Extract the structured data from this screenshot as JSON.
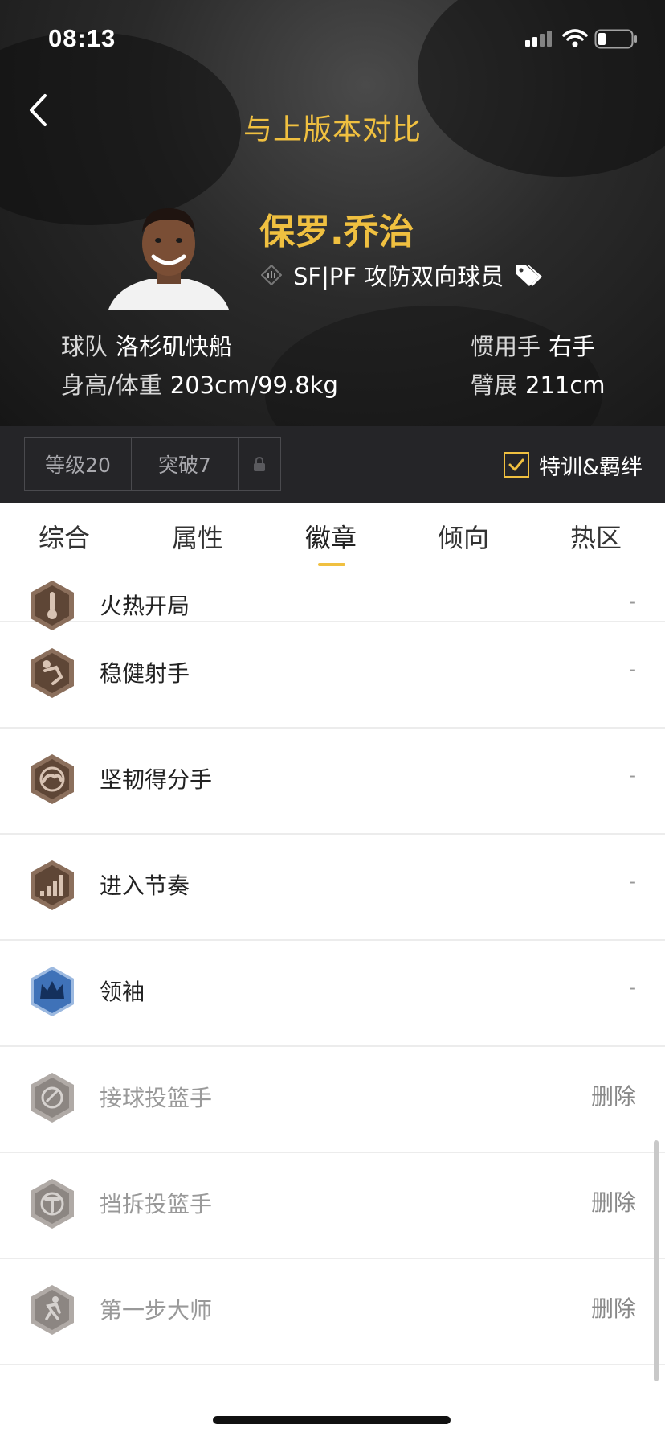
{
  "status_bar": {
    "time": "08:13"
  },
  "header": {
    "title": "与上版本对比"
  },
  "player": {
    "name": "保罗.乔治",
    "position": "SF|PF 攻防双向球员",
    "team_label": "球队",
    "team_value": "洛杉矶快船",
    "height_weight_label": "身高/体重",
    "height_weight_value": "203cm/99.8kg",
    "hand_label": "惯用手",
    "hand_value": "右手",
    "wingspan_label": "臂展",
    "wingspan_value": "211cm"
  },
  "level_bar": {
    "level": "等级20",
    "breakthrough": "突破7",
    "training_label": "特训&羁绊",
    "training_checked": true
  },
  "tabs": [
    {
      "label": "综合"
    },
    {
      "label": "属性"
    },
    {
      "label": "徽章",
      "active": true
    },
    {
      "label": "倾向"
    },
    {
      "label": "热区"
    }
  ],
  "badges": [
    {
      "name": "火热开局",
      "status": "-",
      "icon": "thermometer-badge-icon",
      "tier": "bronze"
    },
    {
      "name": "稳健射手",
      "status": "-",
      "icon": "shooter-badge-icon",
      "tier": "bronze"
    },
    {
      "name": "坚韧得分手",
      "status": "-",
      "icon": "muscle-badge-icon",
      "tier": "bronze"
    },
    {
      "name": "进入节奏",
      "status": "-",
      "icon": "rhythm-bars-badge-icon",
      "tier": "bronze"
    },
    {
      "name": "领袖",
      "status": "-",
      "icon": "crown-badge-icon",
      "tier": "blue"
    },
    {
      "name": "接球投篮手",
      "status": "删除",
      "icon": "catch-shoot-badge-icon",
      "tier": "removed"
    },
    {
      "name": "挡拆投篮手",
      "status": "删除",
      "icon": "pick-roll-badge-icon",
      "tier": "removed"
    },
    {
      "name": "第一步大师",
      "status": "删除",
      "icon": "first-step-badge-icon",
      "tier": "removed"
    }
  ],
  "colors": {
    "accent": "#f0c040",
    "bronze": "#8b6f5c",
    "blue_badge": "#3f72b8",
    "removed": "#9a9a9a"
  }
}
